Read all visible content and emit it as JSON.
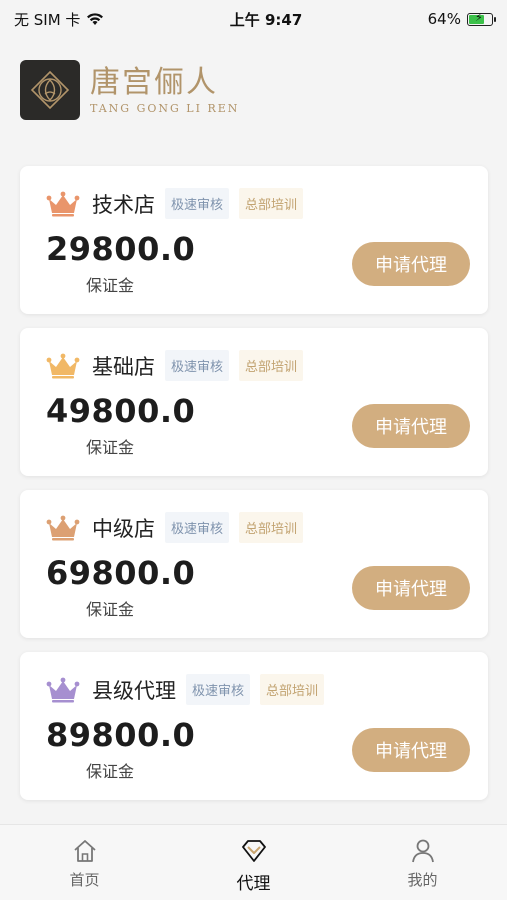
{
  "status_bar": {
    "carrier": "无 SIM 卡",
    "time": "上午 9:47",
    "battery": "64%",
    "battery_level": 0.64
  },
  "header": {
    "logo_cn": "唐宫俪人",
    "logo_en": "TANG GONG LI REN"
  },
  "cards": [
    {
      "title": "技术店",
      "tag_fast": "极速审核",
      "tag_train": "总部培训",
      "price": "29800.0",
      "sub": "保证金",
      "button": "申请代理",
      "crown_color": "#e9956b"
    },
    {
      "title": "基础店",
      "tag_fast": "极速审核",
      "tag_train": "总部培训",
      "price": "49800.0",
      "sub": "保证金",
      "button": "申请代理",
      "crown_color": "#f1b866"
    },
    {
      "title": "中级店",
      "tag_fast": "极速审核",
      "tag_train": "总部培训",
      "price": "69800.0",
      "sub": "保证金",
      "button": "申请代理",
      "crown_color": "#dca073"
    },
    {
      "title": "县级代理",
      "tag_fast": "极速审核",
      "tag_train": "总部培训",
      "price": "89800.0",
      "sub": "保证金",
      "button": "申请代理",
      "crown_color": "#a68fd0"
    }
  ],
  "tabbar": {
    "items": [
      {
        "label": "首页",
        "icon": "home-icon",
        "active": false
      },
      {
        "label": "代理",
        "icon": "diamond-icon",
        "active": true
      },
      {
        "label": "我的",
        "icon": "user-icon",
        "active": false
      }
    ]
  },
  "colors": {
    "accent": "#d2ae80",
    "logo_gold": "#b1946a"
  }
}
